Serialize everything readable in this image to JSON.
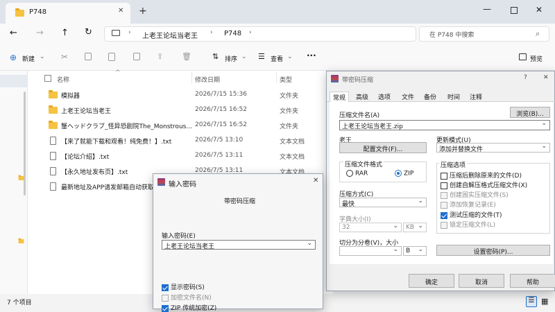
{
  "explorer": {
    "tab_title": "P748",
    "breadcrumb": [
      "上老王论坛当老王",
      "P748"
    ],
    "search_placeholder": "在 P748 中搜索",
    "toolbar": {
      "new_label": "新建",
      "sort_label": "排序",
      "view_label": "查看",
      "more_label": "···",
      "preview_label": "预览"
    },
    "columns": {
      "name": "名称",
      "date": "修改日期",
      "type": "类型"
    },
    "files": [
      {
        "name": "模拟器",
        "date": "2026/7/15 15:36",
        "type": "文件夹",
        "kind": "folder"
      },
      {
        "name": "上老王论坛当老王",
        "date": "2026/7/15 16:52",
        "type": "文件夹",
        "kind": "folder"
      },
      {
        "name": "蟹ヘッドクラブ_怪异恐剧院The_Monstrous...",
        "date": "2026/7/15 16:52",
        "type": "文件夹",
        "kind": "folder"
      },
      {
        "name": "【来了就能下载和观看！纯免费！】.txt",
        "date": "2026/7/5 13:10",
        "type": "文本文档",
        "kind": "txt"
      },
      {
        "name": "【论坛介绍】.txt",
        "date": "2026/7/5 13:11",
        "type": "文本文档",
        "kind": "txt"
      },
      {
        "name": "【永久地址发布页】.txt",
        "date": "2026/7/5 13:11",
        "type": "文本文档",
        "kind": "txt"
      },
      {
        "name": "最新地址及APP请发邮箱自动获取.txt",
        "date": "",
        "type": "",
        "kind": "txt"
      }
    ],
    "status_count": "7 个项目"
  },
  "archive_dialog": {
    "title": "带密码压缩",
    "help": "?",
    "close": "✕",
    "tabs": [
      "常规",
      "高级",
      "选项",
      "文件",
      "备份",
      "时间",
      "注释"
    ],
    "archive_name_label": "压缩文件名(A)",
    "browse_label": "浏览(B)...",
    "archive_name_value": "上老王论坛当老王.zip",
    "profile_label": "老王",
    "profiles_button": "配置文件(F)...",
    "update_mode_label": "更新模式(U)",
    "update_mode_value": "添加并替换文件",
    "format_group": "压缩文件格式",
    "format_rar": "RAR",
    "format_zip": "ZIP",
    "options_group": "压缩选项",
    "options": [
      {
        "label": "压缩后删除原来的文件(D)",
        "checked": false,
        "disabled": false
      },
      {
        "label": "创建自解压格式压缩文件(X)",
        "checked": false,
        "disabled": false
      },
      {
        "label": "创建固实压缩文件(S)",
        "checked": false,
        "disabled": true
      },
      {
        "label": "添加恢复记录(E)",
        "checked": false,
        "disabled": true
      },
      {
        "label": "测试压缩的文件(T)",
        "checked": true,
        "disabled": false
      },
      {
        "label": "锁定压缩文件(L)",
        "checked": false,
        "disabled": true
      }
    ],
    "method_label": "压缩方式(C)",
    "method_value": "最快",
    "dict_label": "字典大小(I)",
    "dict_value": "32",
    "dict_unit": "KB",
    "split_label": "切分为分卷(V)，大小",
    "split_value": "",
    "split_unit": "B",
    "set_password_button": "设置密码(P)...",
    "ok": "确定",
    "cancel": "取消",
    "help_button": "帮助"
  },
  "password_dialog": {
    "title": "输入密码",
    "close": "✕",
    "subtitle": "带密码压缩",
    "enter_label": "输入密码(E)",
    "password_value": "上老王论坛当老王",
    "show_password": "显示密码(S)",
    "encrypt_names": "加密文件名(N)",
    "zip_legacy": "ZIP 传统加密(Z)"
  }
}
